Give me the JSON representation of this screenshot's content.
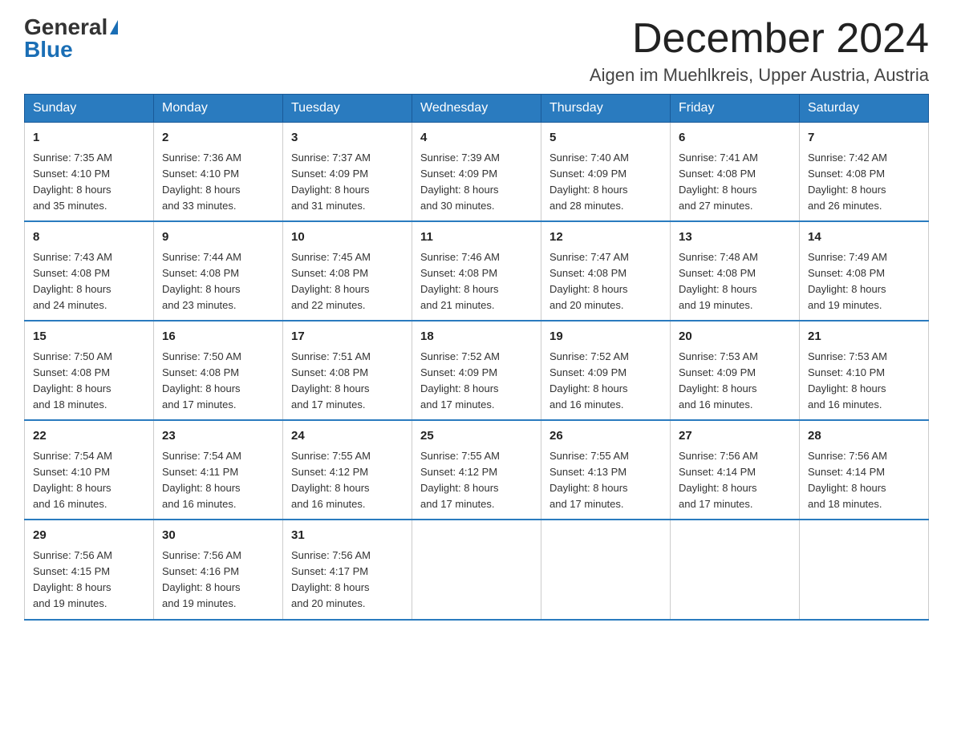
{
  "header": {
    "logo_general": "General",
    "logo_blue": "Blue",
    "month_title": "December 2024",
    "location": "Aigen im Muehlkreis, Upper Austria, Austria"
  },
  "weekdays": [
    "Sunday",
    "Monday",
    "Tuesday",
    "Wednesday",
    "Thursday",
    "Friday",
    "Saturday"
  ],
  "weeks": [
    [
      {
        "day": "1",
        "sunrise": "7:35 AM",
        "sunset": "4:10 PM",
        "daylight_hours": "8 hours",
        "daylight_minutes": "35 minutes"
      },
      {
        "day": "2",
        "sunrise": "7:36 AM",
        "sunset": "4:10 PM",
        "daylight_hours": "8 hours",
        "daylight_minutes": "33 minutes"
      },
      {
        "day": "3",
        "sunrise": "7:37 AM",
        "sunset": "4:09 PM",
        "daylight_hours": "8 hours",
        "daylight_minutes": "31 minutes"
      },
      {
        "day": "4",
        "sunrise": "7:39 AM",
        "sunset": "4:09 PM",
        "daylight_hours": "8 hours",
        "daylight_minutes": "30 minutes"
      },
      {
        "day": "5",
        "sunrise": "7:40 AM",
        "sunset": "4:09 PM",
        "daylight_hours": "8 hours",
        "daylight_minutes": "28 minutes"
      },
      {
        "day": "6",
        "sunrise": "7:41 AM",
        "sunset": "4:08 PM",
        "daylight_hours": "8 hours",
        "daylight_minutes": "27 minutes"
      },
      {
        "day": "7",
        "sunrise": "7:42 AM",
        "sunset": "4:08 PM",
        "daylight_hours": "8 hours",
        "daylight_minutes": "26 minutes"
      }
    ],
    [
      {
        "day": "8",
        "sunrise": "7:43 AM",
        "sunset": "4:08 PM",
        "daylight_hours": "8 hours",
        "daylight_minutes": "24 minutes"
      },
      {
        "day": "9",
        "sunrise": "7:44 AM",
        "sunset": "4:08 PM",
        "daylight_hours": "8 hours",
        "daylight_minutes": "23 minutes"
      },
      {
        "day": "10",
        "sunrise": "7:45 AM",
        "sunset": "4:08 PM",
        "daylight_hours": "8 hours",
        "daylight_minutes": "22 minutes"
      },
      {
        "day": "11",
        "sunrise": "7:46 AM",
        "sunset": "4:08 PM",
        "daylight_hours": "8 hours",
        "daylight_minutes": "21 minutes"
      },
      {
        "day": "12",
        "sunrise": "7:47 AM",
        "sunset": "4:08 PM",
        "daylight_hours": "8 hours",
        "daylight_minutes": "20 minutes"
      },
      {
        "day": "13",
        "sunrise": "7:48 AM",
        "sunset": "4:08 PM",
        "daylight_hours": "8 hours",
        "daylight_minutes": "19 minutes"
      },
      {
        "day": "14",
        "sunrise": "7:49 AM",
        "sunset": "4:08 PM",
        "daylight_hours": "8 hours",
        "daylight_minutes": "19 minutes"
      }
    ],
    [
      {
        "day": "15",
        "sunrise": "7:50 AM",
        "sunset": "4:08 PM",
        "daylight_hours": "8 hours",
        "daylight_minutes": "18 minutes"
      },
      {
        "day": "16",
        "sunrise": "7:50 AM",
        "sunset": "4:08 PM",
        "daylight_hours": "8 hours",
        "daylight_minutes": "17 minutes"
      },
      {
        "day": "17",
        "sunrise": "7:51 AM",
        "sunset": "4:08 PM",
        "daylight_hours": "8 hours",
        "daylight_minutes": "17 minutes"
      },
      {
        "day": "18",
        "sunrise": "7:52 AM",
        "sunset": "4:09 PM",
        "daylight_hours": "8 hours",
        "daylight_minutes": "17 minutes"
      },
      {
        "day": "19",
        "sunrise": "7:52 AM",
        "sunset": "4:09 PM",
        "daylight_hours": "8 hours",
        "daylight_minutes": "16 minutes"
      },
      {
        "day": "20",
        "sunrise": "7:53 AM",
        "sunset": "4:09 PM",
        "daylight_hours": "8 hours",
        "daylight_minutes": "16 minutes"
      },
      {
        "day": "21",
        "sunrise": "7:53 AM",
        "sunset": "4:10 PM",
        "daylight_hours": "8 hours",
        "daylight_minutes": "16 minutes"
      }
    ],
    [
      {
        "day": "22",
        "sunrise": "7:54 AM",
        "sunset": "4:10 PM",
        "daylight_hours": "8 hours",
        "daylight_minutes": "16 minutes"
      },
      {
        "day": "23",
        "sunrise": "7:54 AM",
        "sunset": "4:11 PM",
        "daylight_hours": "8 hours",
        "daylight_minutes": "16 minutes"
      },
      {
        "day": "24",
        "sunrise": "7:55 AM",
        "sunset": "4:12 PM",
        "daylight_hours": "8 hours",
        "daylight_minutes": "16 minutes"
      },
      {
        "day": "25",
        "sunrise": "7:55 AM",
        "sunset": "4:12 PM",
        "daylight_hours": "8 hours",
        "daylight_minutes": "17 minutes"
      },
      {
        "day": "26",
        "sunrise": "7:55 AM",
        "sunset": "4:13 PM",
        "daylight_hours": "8 hours",
        "daylight_minutes": "17 minutes"
      },
      {
        "day": "27",
        "sunrise": "7:56 AM",
        "sunset": "4:14 PM",
        "daylight_hours": "8 hours",
        "daylight_minutes": "17 minutes"
      },
      {
        "day": "28",
        "sunrise": "7:56 AM",
        "sunset": "4:14 PM",
        "daylight_hours": "8 hours",
        "daylight_minutes": "18 minutes"
      }
    ],
    [
      {
        "day": "29",
        "sunrise": "7:56 AM",
        "sunset": "4:15 PM",
        "daylight_hours": "8 hours",
        "daylight_minutes": "19 minutes"
      },
      {
        "day": "30",
        "sunrise": "7:56 AM",
        "sunset": "4:16 PM",
        "daylight_hours": "8 hours",
        "daylight_minutes": "19 minutes"
      },
      {
        "day": "31",
        "sunrise": "7:56 AM",
        "sunset": "4:17 PM",
        "daylight_hours": "8 hours",
        "daylight_minutes": "20 minutes"
      },
      null,
      null,
      null,
      null
    ]
  ]
}
